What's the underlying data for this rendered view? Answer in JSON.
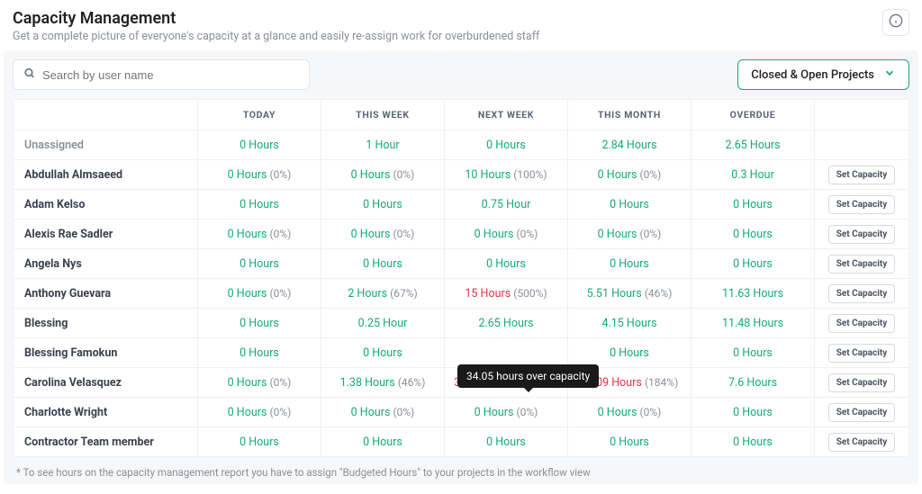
{
  "header": {
    "title": "Capacity Management",
    "subtitle": "Get a complete picture of everyone's capacity at a glance and easily re-assign work for overburdened staff"
  },
  "search": {
    "placeholder": "Search by user name"
  },
  "filter": {
    "label": "Closed & Open Projects"
  },
  "columns": [
    "",
    "TODAY",
    "THIS WEEK",
    "NEXT WEEK",
    "THIS MONTH",
    "OVERDUE",
    ""
  ],
  "set_capacity_label": "Set Capacity",
  "tooltip": "34.05 hours over capacity",
  "footnote": "* To see hours on the capacity management report you have to assign \"Budgeted Hours\" to your projects in the workflow view",
  "rows": [
    {
      "name": "Unassigned",
      "cells": [
        {
          "v": "0 Hours",
          "c": "green"
        },
        {
          "v": "1 Hour",
          "c": "green"
        },
        {
          "v": "0 Hours",
          "c": "green"
        },
        {
          "v": "2.84 Hours",
          "c": "green"
        },
        {
          "v": "2.65 Hours",
          "c": "green"
        }
      ],
      "action": false
    },
    {
      "name": "Abdullah Almsaeed",
      "cells": [
        {
          "v": "0 Hours",
          "p": "(0%)",
          "c": "green"
        },
        {
          "v": "0 Hours",
          "p": "(0%)",
          "c": "green"
        },
        {
          "v": "10 Hours",
          "p": "(100%)",
          "c": "green"
        },
        {
          "v": "0 Hours",
          "p": "(0%)",
          "c": "green"
        },
        {
          "v": "0.3 Hour",
          "c": "green"
        }
      ],
      "action": true
    },
    {
      "name": "Adam Kelso",
      "cells": [
        {
          "v": "0 Hours",
          "c": "green"
        },
        {
          "v": "0 Hours",
          "c": "green"
        },
        {
          "v": "0.75 Hour",
          "c": "green"
        },
        {
          "v": "0 Hours",
          "c": "green"
        },
        {
          "v": "0 Hours",
          "c": "green"
        }
      ],
      "action": true
    },
    {
      "name": "Alexis Rae Sadler",
      "cells": [
        {
          "v": "0 Hours",
          "p": "(0%)",
          "c": "green"
        },
        {
          "v": "0 Hours",
          "p": "(0%)",
          "c": "green"
        },
        {
          "v": "0 Hours",
          "p": "(0%)",
          "c": "green"
        },
        {
          "v": "0 Hours",
          "p": "(0%)",
          "c": "green"
        },
        {
          "v": "0 Hours",
          "c": "green"
        }
      ],
      "action": true
    },
    {
      "name": "Angela Nys",
      "cells": [
        {
          "v": "0 Hours",
          "c": "green"
        },
        {
          "v": "0 Hours",
          "c": "green"
        },
        {
          "v": "0 Hours",
          "c": "green"
        },
        {
          "v": "0 Hours",
          "c": "green"
        },
        {
          "v": "0 Hours",
          "c": "green"
        }
      ],
      "action": true
    },
    {
      "name": "Anthony Guevara",
      "cells": [
        {
          "v": "0 Hours",
          "p": "(0%)",
          "c": "green"
        },
        {
          "v": "2 Hours",
          "p": "(67%)",
          "c": "green"
        },
        {
          "v": "15 Hours",
          "p": "(500%)",
          "c": "red"
        },
        {
          "v": "5.51 Hours",
          "p": "(46%)",
          "c": "green"
        },
        {
          "v": "11.63 Hours",
          "c": "green"
        }
      ],
      "action": true
    },
    {
      "name": "Blessing",
      "cells": [
        {
          "v": "0 Hours",
          "c": "green"
        },
        {
          "v": "0.25 Hour",
          "c": "green"
        },
        {
          "v": "2.65 Hours",
          "c": "green"
        },
        {
          "v": "4.15 Hours",
          "c": "green"
        },
        {
          "v": "11.48 Hours",
          "c": "green"
        }
      ],
      "action": true
    },
    {
      "name": "Blessing Famokun",
      "cells": [
        {
          "v": "0 Hours",
          "c": "green"
        },
        {
          "v": "0 Hours",
          "c": "green"
        },
        {
          "v": "",
          "c": "green"
        },
        {
          "v": "0 Hours",
          "c": "green"
        },
        {
          "v": "0 Hours",
          "c": "green"
        }
      ],
      "action": true
    },
    {
      "name": "Carolina Velasquez",
      "cells": [
        {
          "v": "0 Hours",
          "p": "(0%)",
          "c": "green"
        },
        {
          "v": "1.38 Hours",
          "p": "(46%)",
          "c": "green"
        },
        {
          "v": "37.05 Hours",
          "p": "(1235%)",
          "c": "red"
        },
        {
          "v": "22.09 Hours",
          "p": "(184%)",
          "c": "red"
        },
        {
          "v": "7.6 Hours",
          "c": "green"
        }
      ],
      "action": true
    },
    {
      "name": "Charlotte Wright",
      "cells": [
        {
          "v": "0 Hours",
          "p": "(0%)",
          "c": "green"
        },
        {
          "v": "0 Hours",
          "p": "(0%)",
          "c": "green"
        },
        {
          "v": "0 Hours",
          "p": "(0%)",
          "c": "green"
        },
        {
          "v": "0 Hours",
          "p": "(0%)",
          "c": "green"
        },
        {
          "v": "0 Hours",
          "c": "green"
        }
      ],
      "action": true
    },
    {
      "name": "Contractor Team member",
      "cells": [
        {
          "v": "0 Hours",
          "c": "green"
        },
        {
          "v": "0 Hours",
          "c": "green"
        },
        {
          "v": "0 Hours",
          "c": "green"
        },
        {
          "v": "0 Hours",
          "c": "green"
        },
        {
          "v": "0 Hours",
          "c": "green"
        }
      ],
      "action": true
    }
  ]
}
